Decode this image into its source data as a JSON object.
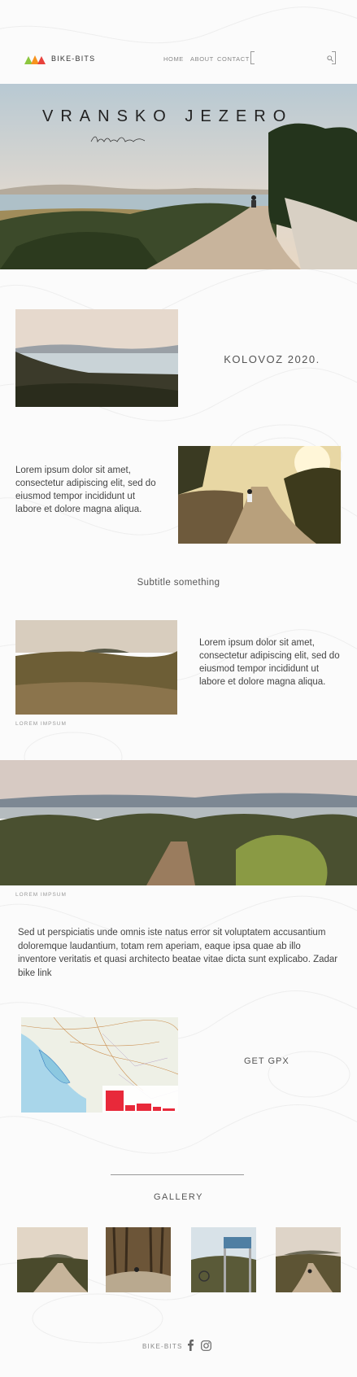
{
  "header": {
    "brand": "BIKE-BITS",
    "nav": [
      {
        "label": "HOME"
      },
      {
        "label": "ABOUT"
      },
      {
        "label": "CONTACT"
      }
    ]
  },
  "hero": {
    "title": "VRANSKO JEZERO",
    "signature": "bacchhom"
  },
  "sections": {
    "date": "KOLOVOZ 2020.",
    "paragraph_1": "Lorem ipsum dolor sit amet, consectetur adipiscing elit, sed do eiusmod tempor incididunt ut labore et dolore magna aliqua.",
    "subtitle": "Subtitle something",
    "paragraph_2": "Lorem ipsum dolor sit amet, consectetur adipiscing elit, sed do eiusmod tempor incididunt ut labore et dolore magna aliqua.",
    "caption_1": "LOREM IMPSUM",
    "caption_2": "LOREM IMPSUM",
    "paragraph_3": "Sed ut perspiciatis unde omnis iste natus error sit voluptatem accusantium doloremque laudantium, totam rem aperiam, eaque ipsa quae ab illo inventore veritatis et quasi architecto beatae vitae dicta sunt explicabo. Zadar bike link",
    "gpx_label": "GET GPX",
    "gallery_title": "GALLERY"
  },
  "footer": {
    "brand": "BIKE-BITS"
  },
  "colors": {
    "logo_green": "#8cc63f",
    "logo_orange": "#f7931e",
    "logo_red": "#e8413c",
    "elevation_red": "#e8293a"
  }
}
